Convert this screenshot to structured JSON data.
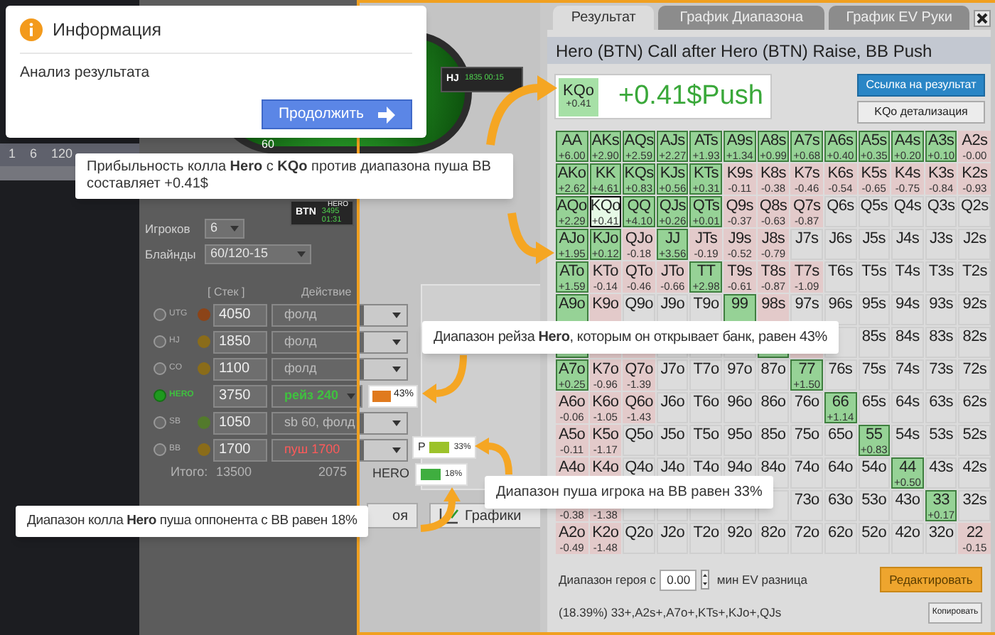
{
  "dialog": {
    "title": "Информация",
    "message": "Анализ результата",
    "button": "Продолжить"
  },
  "session_row": [
    "1",
    "6",
    "120"
  ],
  "table": {
    "pot": "60",
    "seats": [
      {
        "kind": "hj",
        "position": "HJ",
        "stack_time": "1835 00:15"
      },
      {
        "kind": "btn",
        "position": "BTN",
        "name": "HERO",
        "stack_time": "3495 01:31"
      }
    ]
  },
  "settings": [
    {
      "label": "Игроков",
      "value": "6"
    },
    {
      "label": "Блайнды",
      "value": "60/120-15"
    }
  ],
  "columns": [
    "[ Стек ]",
    "Действие"
  ],
  "players": [
    {
      "position": "UTG",
      "color": "#8c4418",
      "stack": "4050",
      "action": "фолд",
      "kind": "fold",
      "selected": false
    },
    {
      "position": "HJ",
      "color": "#8a6c1a",
      "stack": "1850",
      "action": "фолд",
      "kind": "fold",
      "selected": false
    },
    {
      "position": "CO",
      "color": "#8a6c1a",
      "stack": "1100",
      "action": "фолд",
      "kind": "fold",
      "selected": false
    },
    {
      "position": "HERO",
      "stack": "3750",
      "action": "рейз 240",
      "kind": "raise",
      "selected": true,
      "range": {
        "color": "#e07a1e",
        "percent": "43%"
      }
    },
    {
      "position": "SB",
      "color": "#537a2c",
      "stack": "1050",
      "action": "sb 60, фолд",
      "kind": "fold",
      "selected": false
    },
    {
      "position": "BB",
      "color": "#8a6c1a",
      "stack": "1700",
      "action": "пуш 1700",
      "kind": "push",
      "selected": false
    }
  ],
  "totals": {
    "label": "Итого:",
    "stack": "13500",
    "action": "2075"
  },
  "ranges": [
    {
      "kind": "push",
      "label": "P",
      "color": "#9cc22a",
      "percent": "33%"
    },
    {
      "kind": "call",
      "label": "HERO",
      "color": "#3fae3f",
      "percent": "18%"
    }
  ],
  "bottom_buttons": [
    {
      "kind": "cut",
      "label": "оя"
    },
    {
      "kind": "charts",
      "label": "Графики"
    }
  ],
  "tooltips": [
    {
      "kind": "profit",
      "text": "Прибыльность колла **Hero** с **KQo** против диапазона пуша BB составляет +0.41$"
    },
    {
      "kind": "raise",
      "text": "Диапазон рейза **Hero**, которым он открывает банк, равен 43%"
    },
    {
      "kind": "push",
      "text": "Диапазон пуша игрока на BB равен 33%"
    },
    {
      "kind": "call",
      "text": "Диапазон колла **Hero** пуша оппонента с BB равен 18%"
    }
  ],
  "result": {
    "tabs": [
      {
        "label": "Результат",
        "selected": true
      },
      {
        "label": "График Диапазона",
        "selected": false
      },
      {
        "label": "График EV Руки",
        "selected": false
      }
    ],
    "title": "Hero (BTN) Call after Hero (BTN) Raise, BB Push",
    "hand": "KQo",
    "hand_ev": "+0.41",
    "headline": "+0.41$Push",
    "link_button": "Ссылка на результат",
    "detail_button": "KQo детализация",
    "grid": [
      [
        {
          "hand": "AA",
          "ev": "+6.00",
          "kind": "plus",
          "selected": false
        },
        {
          "hand": "AKs",
          "ev": "+2.90",
          "kind": "plus",
          "selected": false
        },
        {
          "hand": "AQs",
          "ev": "+2.59",
          "kind": "plus",
          "selected": false
        },
        {
          "hand": "AJs",
          "ev": "+2.27",
          "kind": "plus",
          "selected": false
        },
        {
          "hand": "ATs",
          "ev": "+1.93",
          "kind": "plus",
          "selected": false
        },
        {
          "hand": "A9s",
          "ev": "+1.34",
          "kind": "plus",
          "selected": false
        },
        {
          "hand": "A8s",
          "ev": "+0.99",
          "kind": "plus",
          "selected": false
        },
        {
          "hand": "A7s",
          "ev": "+0.68",
          "kind": "plus",
          "selected": false
        },
        {
          "hand": "A6s",
          "ev": "+0.40",
          "kind": "plus",
          "selected": false
        },
        {
          "hand": "A5s",
          "ev": "+0.35",
          "kind": "plus",
          "selected": false
        },
        {
          "hand": "A4s",
          "ev": "+0.20",
          "kind": "plus",
          "selected": false
        },
        {
          "hand": "A3s",
          "ev": "+0.10",
          "kind": "plus",
          "selected": false
        },
        {
          "hand": "A2s",
          "ev": "-0.00",
          "kind": "minus",
          "selected": false
        }
      ],
      [
        {
          "hand": "AKo",
          "ev": "+2.62",
          "kind": "plus",
          "selected": false
        },
        {
          "hand": "KK",
          "ev": "+4.61",
          "kind": "plus",
          "selected": false
        },
        {
          "hand": "KQs",
          "ev": "+0.83",
          "kind": "plus",
          "selected": false
        },
        {
          "hand": "KJs",
          "ev": "+0.56",
          "kind": "plus",
          "selected": false
        },
        {
          "hand": "KTs",
          "ev": "+0.31",
          "kind": "plus",
          "selected": false
        },
        {
          "hand": "K9s",
          "ev": "-0.11",
          "kind": "minus",
          "selected": false
        },
        {
          "hand": "K8s",
          "ev": "-0.38",
          "kind": "minus",
          "selected": false
        },
        {
          "hand": "K7s",
          "ev": "-0.46",
          "kind": "minus",
          "selected": false
        },
        {
          "hand": "K6s",
          "ev": "-0.54",
          "kind": "minus",
          "selected": false
        },
        {
          "hand": "K5s",
          "ev": "-0.65",
          "kind": "minus",
          "selected": false
        },
        {
          "hand": "K4s",
          "ev": "-0.75",
          "kind": "minus",
          "selected": false
        },
        {
          "hand": "K3s",
          "ev": "-0.84",
          "kind": "minus",
          "selected": false
        },
        {
          "hand": "K2s",
          "ev": "-0.93",
          "kind": "minus",
          "selected": false
        }
      ],
      [
        {
          "hand": "AQo",
          "ev": "+2.29",
          "kind": "plus",
          "selected": false
        },
        {
          "hand": "KQo",
          "ev": "+0.41",
          "kind": "plus",
          "selected": true
        },
        {
          "hand": "QQ",
          "ev": "+4.10",
          "kind": "plus",
          "selected": false
        },
        {
          "hand": "QJs",
          "ev": "+0.26",
          "kind": "plus",
          "selected": false
        },
        {
          "hand": "QTs",
          "ev": "+0.01",
          "kind": "plus",
          "selected": false
        },
        {
          "hand": "Q9s",
          "ev": "-0.37",
          "kind": "minus",
          "selected": false
        },
        {
          "hand": "Q8s",
          "ev": "-0.63",
          "kind": "minus",
          "selected": false
        },
        {
          "hand": "Q7s",
          "ev": "-0.87",
          "kind": "minus",
          "selected": false
        },
        {
          "hand": "Q6s",
          "kind": "none",
          "selected": false
        },
        {
          "hand": "Q5s",
          "kind": "none",
          "selected": false
        },
        {
          "hand": "Q4s",
          "kind": "none",
          "selected": false
        },
        {
          "hand": "Q3s",
          "kind": "none",
          "selected": false
        },
        {
          "hand": "Q2s",
          "kind": "none",
          "selected": false
        }
      ],
      [
        {
          "hand": "AJo",
          "ev": "+1.95",
          "kind": "plus",
          "selected": false
        },
        {
          "hand": "KJo",
          "ev": "+0.12",
          "kind": "plus",
          "selected": false
        },
        {
          "hand": "QJo",
          "ev": "-0.18",
          "kind": "minus",
          "selected": false
        },
        {
          "hand": "JJ",
          "ev": "+3.56",
          "kind": "plus",
          "selected": false
        },
        {
          "hand": "JTs",
          "ev": "-0.19",
          "kind": "minus",
          "selected": false
        },
        {
          "hand": "J9s",
          "ev": "-0.52",
          "kind": "minus",
          "selected": false
        },
        {
          "hand": "J8s",
          "ev": "-0.79",
          "kind": "minus",
          "selected": false
        },
        {
          "hand": "J7s",
          "kind": "none",
          "selected": false
        },
        {
          "hand": "J6s",
          "kind": "none",
          "selected": false
        },
        {
          "hand": "J5s",
          "kind": "none",
          "selected": false
        },
        {
          "hand": "J4s",
          "kind": "none",
          "selected": false
        },
        {
          "hand": "J3s",
          "kind": "none",
          "selected": false
        },
        {
          "hand": "J2s",
          "kind": "none",
          "selected": false
        }
      ],
      [
        {
          "hand": "ATo",
          "ev": "+1.59",
          "kind": "plus",
          "selected": false
        },
        {
          "hand": "KTo",
          "ev": "-0.14",
          "kind": "minus",
          "selected": false
        },
        {
          "hand": "QTo",
          "ev": "-0.46",
          "kind": "minus",
          "selected": false
        },
        {
          "hand": "JTo",
          "ev": "-0.66",
          "kind": "minus",
          "selected": false
        },
        {
          "hand": "TT",
          "ev": "+2.98",
          "kind": "plus",
          "selected": false
        },
        {
          "hand": "T9s",
          "ev": "-0.61",
          "kind": "minus",
          "selected": false
        },
        {
          "hand": "T8s",
          "ev": "-0.87",
          "kind": "minus",
          "selected": false
        },
        {
          "hand": "T7s",
          "ev": "-1.09",
          "kind": "minus",
          "selected": false
        },
        {
          "hand": "T6s",
          "kind": "none",
          "selected": false
        },
        {
          "hand": "T5s",
          "kind": "none",
          "selected": false
        },
        {
          "hand": "T4s",
          "kind": "none",
          "selected": false
        },
        {
          "hand": "T3s",
          "kind": "none",
          "selected": false
        },
        {
          "hand": "T2s",
          "kind": "none",
          "selected": false
        }
      ],
      [
        {
          "hand": "A9o",
          "kind": "plus",
          "selected": false
        },
        {
          "hand": "K9o",
          "kind": "minus",
          "selected": false
        },
        {
          "hand": "Q9o",
          "kind": "none",
          "selected": false
        },
        {
          "hand": "J9o",
          "kind": "none",
          "selected": false
        },
        {
          "hand": "T9o",
          "kind": "none",
          "selected": false
        },
        {
          "hand": "99",
          "kind": "plus",
          "selected": false
        },
        {
          "hand": "98s",
          "kind": "minus",
          "selected": false
        },
        {
          "hand": "97s",
          "kind": "none",
          "selected": false
        },
        {
          "hand": "96s",
          "kind": "none",
          "selected": false
        },
        {
          "hand": "95s",
          "kind": "none",
          "selected": false
        },
        {
          "hand": "94s",
          "kind": "none",
          "selected": false
        },
        {
          "hand": "93s",
          "kind": "none",
          "selected": false
        },
        {
          "hand": "92s",
          "kind": "none",
          "selected": false
        }
      ],
      [
        {
          "kind": "plus",
          "selected": false
        },
        {
          "kind": "minus",
          "selected": false
        },
        {
          "kind": "minus",
          "selected": false
        },
        {
          "kind": "none",
          "selected": false
        },
        {
          "kind": "none",
          "selected": false
        },
        {
          "kind": "none",
          "selected": false
        },
        {
          "kind": "plus",
          "selected": false
        },
        {
          "kind": "minus",
          "selected": false
        },
        {
          "kind": "none",
          "selected": false
        },
        {
          "hand": "85s",
          "kind": "none",
          "selected": false
        },
        {
          "hand": "84s",
          "kind": "none",
          "selected": false
        },
        {
          "hand": "83s",
          "kind": "none",
          "selected": false
        },
        {
          "hand": "82s",
          "kind": "none",
          "selected": false
        }
      ],
      [
        {
          "hand": "A7o",
          "ev": "+0.25",
          "kind": "plus",
          "selected": false
        },
        {
          "hand": "K7o",
          "ev": "-0.96",
          "kind": "minus",
          "selected": false
        },
        {
          "hand": "Q7o",
          "ev": "-1.39",
          "kind": "minus",
          "selected": false
        },
        {
          "hand": "J7o",
          "kind": "none",
          "selected": false
        },
        {
          "hand": "T7o",
          "kind": "none",
          "selected": false
        },
        {
          "hand": "97o",
          "kind": "none",
          "selected": false
        },
        {
          "hand": "87o",
          "kind": "none",
          "selected": false
        },
        {
          "hand": "77",
          "ev": "+1.50",
          "kind": "plus",
          "selected": false
        },
        {
          "hand": "76s",
          "kind": "none",
          "selected": false
        },
        {
          "hand": "75s",
          "kind": "none",
          "selected": false
        },
        {
          "hand": "74s",
          "kind": "none",
          "selected": false
        },
        {
          "hand": "73s",
          "kind": "none",
          "selected": false
        },
        {
          "hand": "72s",
          "kind": "none",
          "selected": false
        }
      ],
      [
        {
          "hand": "A6o",
          "ev": "-0.06",
          "kind": "minus",
          "selected": false
        },
        {
          "hand": "K6o",
          "ev": "-1.05",
          "kind": "minus",
          "selected": false
        },
        {
          "hand": "Q6o",
          "ev": "-1.43",
          "kind": "minus",
          "selected": false
        },
        {
          "hand": "J6o",
          "kind": "none",
          "selected": false
        },
        {
          "hand": "T6o",
          "kind": "none",
          "selected": false
        },
        {
          "hand": "96o",
          "kind": "none",
          "selected": false
        },
        {
          "hand": "86o",
          "kind": "none",
          "selected": false
        },
        {
          "hand": "76o",
          "kind": "none",
          "selected": false
        },
        {
          "hand": "66",
          "ev": "+1.14",
          "kind": "plus",
          "selected": false
        },
        {
          "hand": "65s",
          "kind": "none",
          "selected": false
        },
        {
          "hand": "64s",
          "kind": "none",
          "selected": false
        },
        {
          "hand": "63s",
          "kind": "none",
          "selected": false
        },
        {
          "hand": "62s",
          "kind": "none",
          "selected": false
        }
      ],
      [
        {
          "hand": "A5o",
          "ev": "-0.11",
          "kind": "minus",
          "selected": false
        },
        {
          "hand": "K5o",
          "ev": "-1.17",
          "kind": "minus",
          "selected": false
        },
        {
          "hand": "Q5o",
          "kind": "none",
          "selected": false
        },
        {
          "hand": "J5o",
          "kind": "none",
          "selected": false
        },
        {
          "hand": "T5o",
          "kind": "none",
          "selected": false
        },
        {
          "hand": "95o",
          "kind": "none",
          "selected": false
        },
        {
          "hand": "85o",
          "kind": "none",
          "selected": false
        },
        {
          "hand": "75o",
          "kind": "none",
          "selected": false
        },
        {
          "hand": "65o",
          "kind": "none",
          "selected": false
        },
        {
          "hand": "55",
          "ev": "+0.83",
          "kind": "plus",
          "selected": false
        },
        {
          "hand": "54s",
          "kind": "none",
          "selected": false
        },
        {
          "hand": "53s",
          "kind": "none",
          "selected": false
        },
        {
          "hand": "52s",
          "kind": "none",
          "selected": false
        }
      ],
      [
        {
          "hand": "A4o",
          "kind": "minus",
          "selected": false
        },
        {
          "hand": "K4o",
          "kind": "minus",
          "selected": false
        },
        {
          "hand": "Q4o",
          "kind": "none",
          "selected": false
        },
        {
          "hand": "J4o",
          "kind": "none",
          "selected": false
        },
        {
          "hand": "T4o",
          "kind": "none",
          "selected": false
        },
        {
          "hand": "94o",
          "kind": "none",
          "selected": false
        },
        {
          "hand": "84o",
          "kind": "none",
          "selected": false
        },
        {
          "hand": "74o",
          "kind": "none",
          "selected": false
        },
        {
          "hand": "64o",
          "kind": "none",
          "selected": false
        },
        {
          "hand": "54o",
          "kind": "none",
          "selected": false
        },
        {
          "hand": "44",
          "ev": "+0.50",
          "kind": "plus",
          "selected": false
        },
        {
          "hand": "43s",
          "kind": "none",
          "selected": false
        },
        {
          "hand": "42s",
          "kind": "none",
          "selected": false
        }
      ],
      [
        {
          "ev": "-0.38",
          "kind": "minus",
          "selected": false
        },
        {
          "ev": "-1.38",
          "kind": "minus",
          "selected": false
        },
        {
          "kind": "none",
          "selected": false
        },
        {
          "kind": "none",
          "selected": false
        },
        {
          "kind": "none",
          "selected": false
        },
        {
          "kind": "none",
          "selected": false
        },
        {
          "kind": "none",
          "selected": false
        },
        {
          "hand": "73o",
          "kind": "none",
          "selected": false
        },
        {
          "hand": "63o",
          "kind": "none",
          "selected": false
        },
        {
          "hand": "53o",
          "kind": "none",
          "selected": false
        },
        {
          "hand": "43o",
          "kind": "none",
          "selected": false
        },
        {
          "hand": "33",
          "ev": "+0.17",
          "kind": "plus",
          "selected": false
        },
        {
          "hand": "32s",
          "kind": "none",
          "selected": false
        }
      ],
      [
        {
          "hand": "A2o",
          "ev": "-0.49",
          "kind": "minus",
          "selected": false
        },
        {
          "hand": "K2o",
          "ev": "-1.48",
          "kind": "minus",
          "selected": false
        },
        {
          "hand": "Q2o",
          "kind": "none",
          "selected": false
        },
        {
          "hand": "J2o",
          "kind": "none",
          "selected": false
        },
        {
          "hand": "T2o",
          "kind": "none",
          "selected": false
        },
        {
          "hand": "92o",
          "kind": "none",
          "selected": false
        },
        {
          "hand": "82o",
          "kind": "none",
          "selected": false
        },
        {
          "hand": "72o",
          "kind": "none",
          "selected": false
        },
        {
          "hand": "62o",
          "kind": "none",
          "selected": false
        },
        {
          "hand": "52o",
          "kind": "none",
          "selected": false
        },
        {
          "hand": "42o",
          "kind": "none",
          "selected": false
        },
        {
          "hand": "32o",
          "kind": "none",
          "selected": false
        },
        {
          "hand": "22",
          "ev": "-0.15",
          "kind": "minus",
          "selected": false
        }
      ]
    ],
    "range_label": "Диапазон героя с",
    "min_ev": "0.00",
    "min_ev_label": "мин EV разница",
    "edit_button": "Редактировать",
    "range_text": "(18.39%) 33+,A2s+,A7o+,KTs+,KJo+,QJs",
    "copy_button": "Копировать"
  }
}
